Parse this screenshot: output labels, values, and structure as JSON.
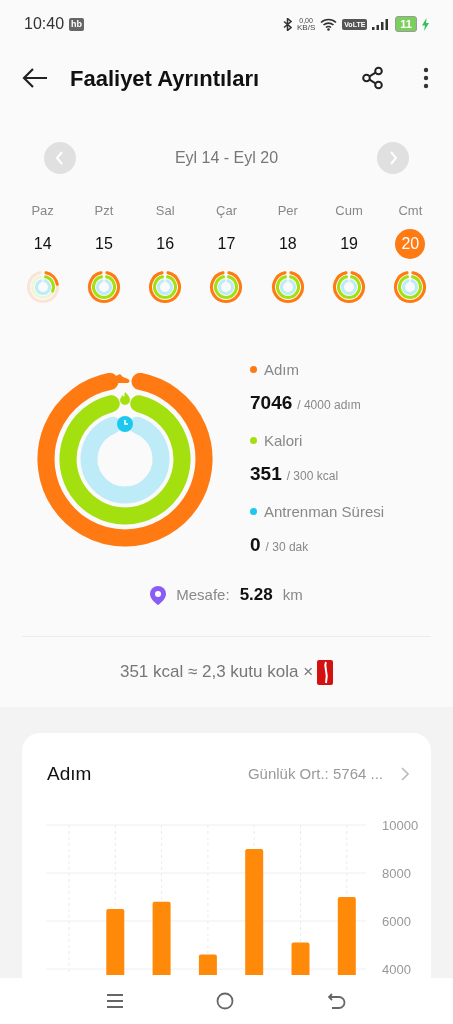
{
  "status_bar": {
    "time": "10:40",
    "badge": "hb",
    "speed_value": "0,00",
    "speed_unit": "KB/S",
    "network_tag": "VoLTE",
    "battery": "11"
  },
  "header": {
    "title": "Faaliyet Ayrıntıları"
  },
  "week": {
    "range": "Eyl 14 - Eyl 20"
  },
  "days": [
    {
      "weekday": "Paz",
      "date": "14",
      "selected": false,
      "rings": [
        {
          "kind": "steps",
          "goal_met": false
        },
        {
          "kind": "calories",
          "goal_met": false
        },
        {
          "kind": "workout",
          "goal_met": false
        }
      ]
    },
    {
      "weekday": "Pzt",
      "date": "15",
      "selected": false,
      "rings": [
        {
          "kind": "steps",
          "goal_met": true
        },
        {
          "kind": "calories",
          "goal_met": true
        },
        {
          "kind": "workout",
          "goal_met": false
        }
      ]
    },
    {
      "weekday": "Sal",
      "date": "16",
      "selected": false,
      "rings": [
        {
          "kind": "steps",
          "goal_met": true
        },
        {
          "kind": "calories",
          "goal_met": true
        },
        {
          "kind": "workout",
          "goal_met": false
        }
      ]
    },
    {
      "weekday": "Çar",
      "date": "17",
      "selected": false,
      "rings": [
        {
          "kind": "steps",
          "goal_met": true
        },
        {
          "kind": "calories",
          "goal_met": true
        },
        {
          "kind": "workout",
          "goal_met": false
        }
      ]
    },
    {
      "weekday": "Per",
      "date": "18",
      "selected": false,
      "rings": [
        {
          "kind": "steps",
          "goal_met": true
        },
        {
          "kind": "calories",
          "goal_met": true
        },
        {
          "kind": "workout",
          "goal_met": false
        }
      ]
    },
    {
      "weekday": "Cum",
      "date": "19",
      "selected": false,
      "rings": [
        {
          "kind": "steps",
          "goal_met": true
        },
        {
          "kind": "calories",
          "goal_met": true
        },
        {
          "kind": "workout",
          "goal_met": false
        }
      ]
    },
    {
      "weekday": "Cmt",
      "date": "20",
      "selected": true,
      "rings": [
        {
          "kind": "steps",
          "goal_met": true
        },
        {
          "kind": "calories",
          "goal_met": true
        },
        {
          "kind": "workout",
          "goal_met": false
        }
      ]
    }
  ],
  "summary": {
    "rings": [
      {
        "kind": "steps",
        "goal_met": true
      },
      {
        "kind": "calories",
        "goal_met": true
      },
      {
        "kind": "workout",
        "goal_met": false
      }
    ],
    "metrics": [
      {
        "label": "Adım",
        "color": "#ff7a12",
        "value": "7046",
        "goal": "/ 4000 adım"
      },
      {
        "label": "Kalori",
        "color": "#a4e00f",
        "value": "351",
        "goal": "/ 300 kcal"
      },
      {
        "label": "Antrenman Süresi",
        "color": "#1dc8f0",
        "value": "0",
        "goal": "/ 30 dak"
      }
    ],
    "distance": {
      "label": "Mesafe:",
      "value": "5.28",
      "unit": "km"
    }
  },
  "kola": {
    "text": "351 kcal ≈ 2,3 kutu kola ×"
  },
  "steps_card": {
    "title": "Adım",
    "average": "Günlük Ort.: 5764 ...",
    "chart_data": {
      "type": "bar",
      "ylim": [
        4000,
        10000
      ],
      "yticks": [
        4000,
        6000,
        8000,
        10000
      ],
      "grid": true,
      "values": [
        null,
        6500,
        6800,
        4600,
        9000,
        5100,
        7000
      ]
    }
  }
}
